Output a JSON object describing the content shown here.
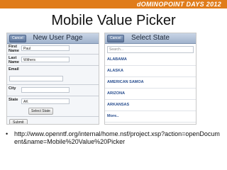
{
  "banner": {
    "text": "dOMINOPOINT DAYS 2012",
    "bg_color": "#e07c1a"
  },
  "slide": {
    "title": "Mobile Value Picker"
  },
  "left_panel": {
    "toolbar": {
      "cancel_label": "Cancel",
      "title": "New User Page"
    },
    "fields": [
      {
        "label": "First Name",
        "value": "Paul"
      },
      {
        "label": "Last Name",
        "value": "Withers"
      },
      {
        "label": "Email",
        "value": ""
      },
      {
        "label": "City",
        "value": ""
      },
      {
        "label": "State",
        "value": "AK"
      }
    ],
    "select_state_label": "Select State",
    "submit_label": "Submit"
  },
  "right_panel": {
    "toolbar": {
      "cancel_label": "Cancel",
      "title": "Select State"
    },
    "search_placeholder": "Search...",
    "states": [
      "ALABAMA",
      "ALASKA",
      "AMERICAN SAMOA",
      "ARIZONA",
      "ARKANSAS",
      "More.."
    ]
  },
  "bullet": {
    "dot": "•",
    "link": "http://www.openntf.org/internal/home.nsf/project.xsp?action=openDocument&name=Mobile%20Value%20Picker"
  }
}
